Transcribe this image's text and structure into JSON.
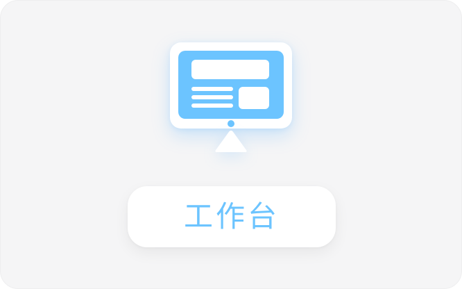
{
  "card": {
    "label": "工作台",
    "icon": "workbench-monitor-icon"
  },
  "colors": {
    "accent": "#6cc4ff",
    "card_background": "#f5f5f6",
    "surface": "#ffffff"
  }
}
